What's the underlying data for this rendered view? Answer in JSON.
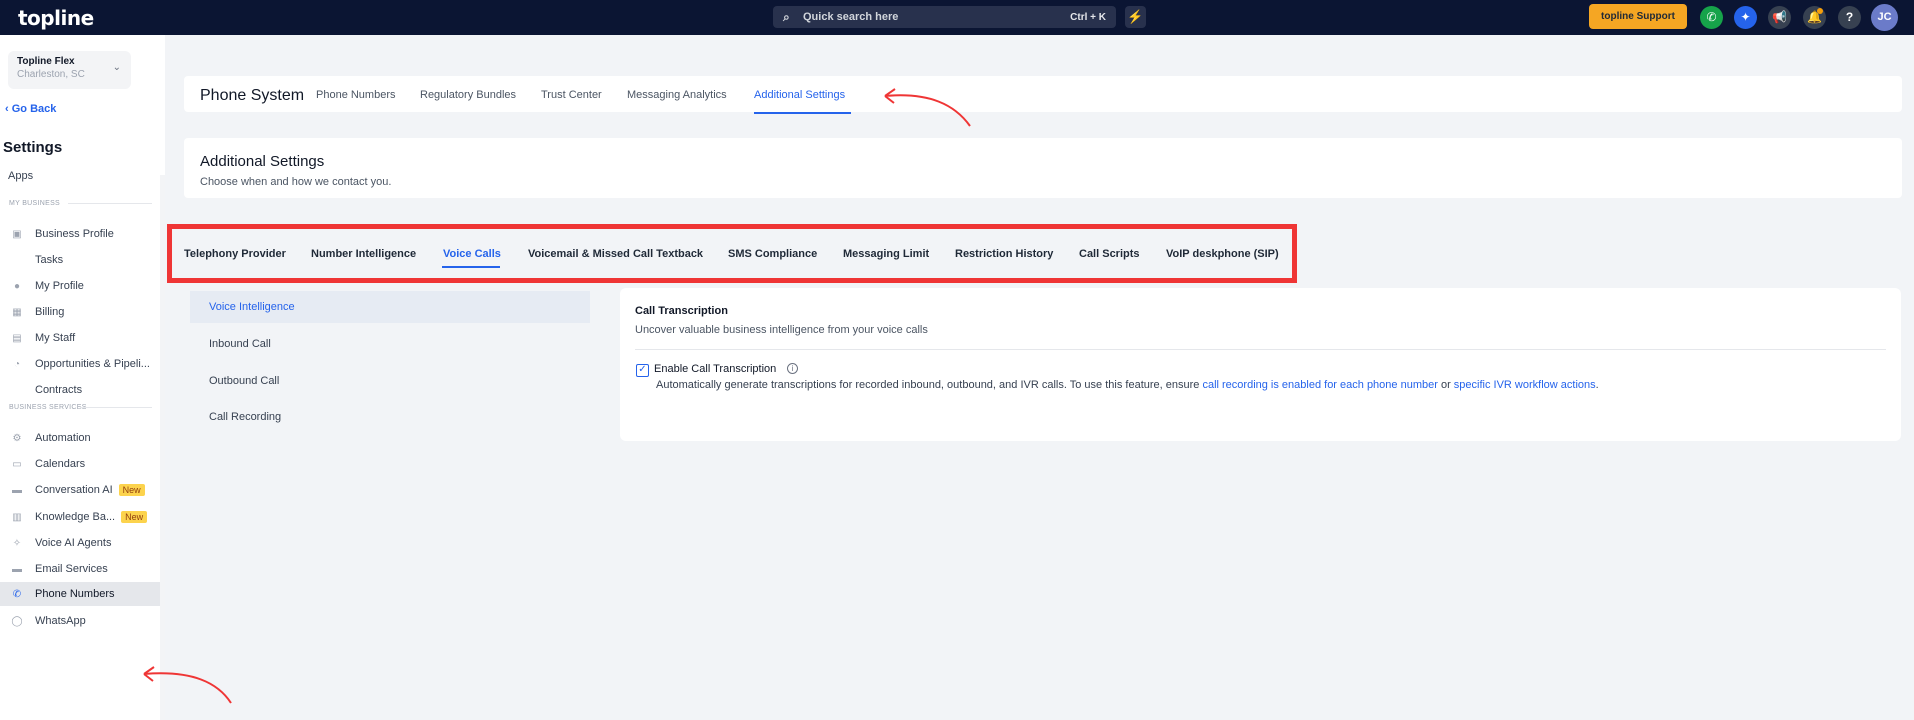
{
  "topbar": {
    "logo": "topline",
    "search_placeholder": "Quick search here",
    "search_shortcut": "Ctrl + K",
    "support_label": "topline Support",
    "avatar_initials": "JC"
  },
  "sidebar": {
    "location_name": "Topline Flex",
    "location_city": "Charleston, SC",
    "go_back": "Go Back",
    "heading": "Settings",
    "apps": "Apps",
    "section_my_business": "MY BUSINESS",
    "section_business_services": "BUSINESS SERVICES",
    "items": [
      {
        "label": "Business Profile"
      },
      {
        "label": "Tasks"
      },
      {
        "label": "My Profile"
      },
      {
        "label": "Billing"
      },
      {
        "label": "My Staff"
      },
      {
        "label": "Opportunities & Pipeli..."
      },
      {
        "label": "Contracts"
      },
      {
        "label": "Automation"
      },
      {
        "label": "Calendars"
      },
      {
        "label": "Conversation AI",
        "badge": "New"
      },
      {
        "label": "Knowledge Ba...",
        "badge": "New"
      },
      {
        "label": "Voice AI Agents"
      },
      {
        "label": "Email Services"
      },
      {
        "label": "Phone Numbers"
      },
      {
        "label": "WhatsApp"
      }
    ]
  },
  "phone_system": {
    "title": "Phone System",
    "tabs": [
      "Phone Numbers",
      "Regulatory Bundles",
      "Trust Center",
      "Messaging Analytics",
      "Additional Settings"
    ],
    "active_tab": "Additional Settings"
  },
  "additional_settings": {
    "title": "Additional Settings",
    "subtitle": "Choose when and how we contact you."
  },
  "sub_tabs": {
    "items": [
      "Telephony Provider",
      "Number Intelligence",
      "Voice Calls",
      "Voicemail & Missed Call Textback",
      "SMS Compliance",
      "Messaging Limit",
      "Restriction History",
      "Call Scripts",
      "VoIP deskphone (SIP)"
    ],
    "active": "Voice Calls"
  },
  "voice_menu": {
    "items": [
      "Voice Intelligence",
      "Inbound Call",
      "Outbound Call",
      "Call Recording"
    ],
    "active": "Voice Intelligence"
  },
  "transcription": {
    "title": "Call Transcription",
    "subtitle": "Uncover valuable business intelligence from your voice calls",
    "checkbox_label": "Enable Call Transcription",
    "checked": true,
    "desc_prefix": "Automatically generate transcriptions for recorded inbound, outbound, and IVR calls. To use this feature, ensure ",
    "link1": "call recording is enabled for each phone number",
    "desc_mid": " or ",
    "link2": "specific IVR workflow actions",
    "desc_suffix": "."
  },
  "colors": {
    "topbar": "#0b1533",
    "accent": "#2563eb",
    "support": "#f5a623",
    "annotation": "#ef3535"
  }
}
